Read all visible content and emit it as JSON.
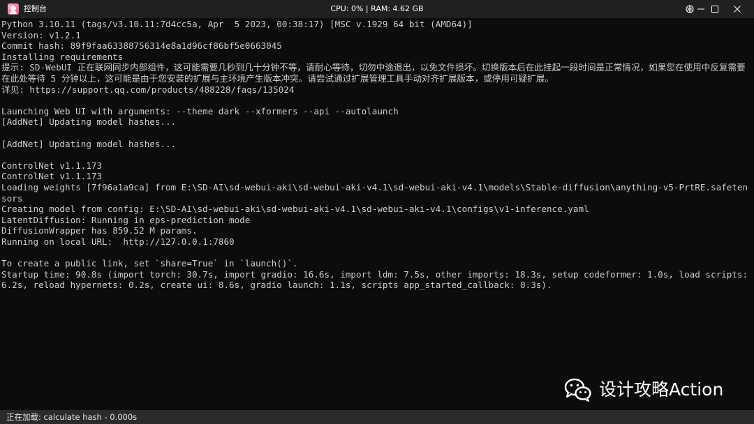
{
  "window": {
    "title": "控制台",
    "cpu_label": "CPU: 0%",
    "separator": " | ",
    "ram_label": "RAM: 4.62 GB"
  },
  "console": {
    "lines": [
      "Python 3.10.11 (tags/v3.10.11:7d4cc5a, Apr  5 2023, 00:38:17) [MSC v.1929 64 bit (AMD64)]",
      "Version: v1.2.1",
      "Commit hash: 89f9faa63388756314e8a1d96cf86bf5e0663045",
      "Installing requirements",
      "提示: SD-WebUI 正在联网同步内部组件，这可能需要几秒到几十分钟不等，请耐心等待，切勿中途退出，以免文件损坏。切换版本后在此挂起一段时间是正常情况，如果您在使用中反复需要在此处等待 5 分钟以上，这可能是由于您安装的扩展与主环境产生版本冲突。请尝试通过扩展管理工具手动对齐扩展版本，或停用可疑扩展。",
      "详见: https://support.qq.com/products/488228/faqs/135024",
      "",
      "Launching Web UI with arguments: --theme dark --xformers --api --autolaunch",
      "[AddNet] Updating model hashes...",
      "",
      "[AddNet] Updating model hashes...",
      "",
      "ControlNet v1.1.173",
      "ControlNet v1.1.173",
      "Loading weights [7f96a1a9ca] from E:\\SD-AI\\sd-webui-aki\\sd-webui-aki-v4.1\\sd-webui-aki-v4.1\\models\\Stable-diffusion\\anything-v5-PrtRE.safetensors",
      "Creating model from config: E:\\SD-AI\\sd-webui-aki\\sd-webui-aki-v4.1\\sd-webui-aki-v4.1\\configs\\v1-inference.yaml",
      "LatentDiffusion: Running in eps-prediction mode",
      "DiffusionWrapper has 859.52 M params.",
      "Running on local URL:  http://127.0.0.1:7860",
      "",
      "To create a public link, set `share=True` in `launch()`.",
      "Startup time: 90.8s (import torch: 30.7s, import gradio: 16.6s, import ldm: 7.5s, other imports: 18.3s, setup codeformer: 1.0s, load scripts: 6.2s, reload hypernets: 0.2s, create ui: 8.6s, gradio launch: 1.1s, scripts app_started_callback: 0.3s)."
    ]
  },
  "watermark": {
    "text": "设计攻略Action",
    "icon": "wechat-icon"
  },
  "status": {
    "text": "正在加载: calculate hash - 0.000s"
  },
  "icons": {
    "app": "app-avatar-icon",
    "ball": "ball-icon",
    "minimize": "minimize-icon",
    "maximize": "maximize-icon",
    "close": "close-icon"
  },
  "colors": {
    "background": "#0c0c0c",
    "text": "#cccccc",
    "titlebar": "#202020",
    "statusbar": "#2b2b2b"
  }
}
